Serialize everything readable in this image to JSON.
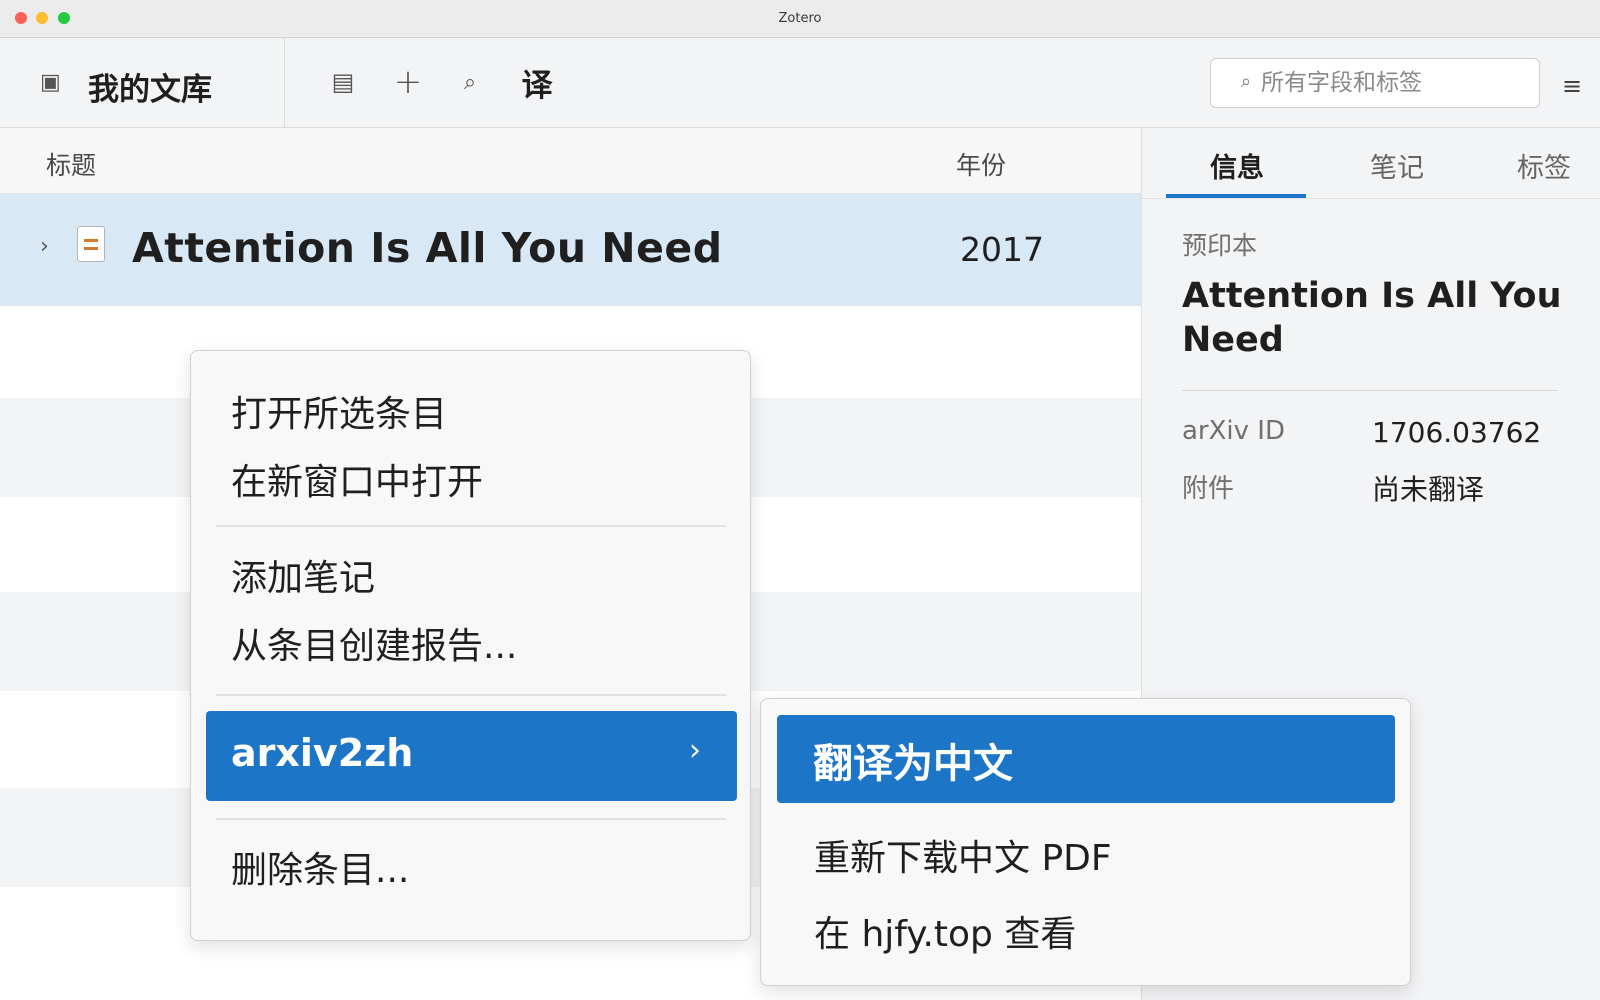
{
  "window": {
    "title": "Zotero"
  },
  "toolbar": {
    "library_title": "我的文库",
    "translate_label": "译",
    "search_placeholder": "所有字段和标签"
  },
  "columns": {
    "title": "标题",
    "year": "年份"
  },
  "items": [
    {
      "title": "Attention Is All You Need",
      "year": "2017"
    }
  ],
  "item_pane": {
    "tabs": [
      "信息",
      "笔记",
      "标签"
    ],
    "item_type": "预印本",
    "title": "Attention Is All You Need",
    "fields": [
      {
        "label": "arXiv ID",
        "value": "1706.03762"
      },
      {
        "label": "附件",
        "value": "尚未翻译"
      }
    ]
  },
  "context_menu": {
    "items": [
      "打开所选条目",
      "在新窗口中打开",
      "添加笔记",
      "从条目创建报告...",
      "arxiv2zh",
      "删除条目..."
    ]
  },
  "submenu": {
    "items": [
      "翻译为中文",
      "重新下载中文 PDF",
      "在 hjfy.top 查看"
    ]
  },
  "icons": {
    "pane_toggle": "pane-toggle-icon",
    "list": "list-icon",
    "add": "plus-icon",
    "locate": "search-icon",
    "menu": "hamburger-icon",
    "document": "document-icon"
  },
  "colors": {
    "accent": "#1d75c7",
    "selected_row": "#d9e8f5",
    "doc_icon": "#d07b2b"
  }
}
